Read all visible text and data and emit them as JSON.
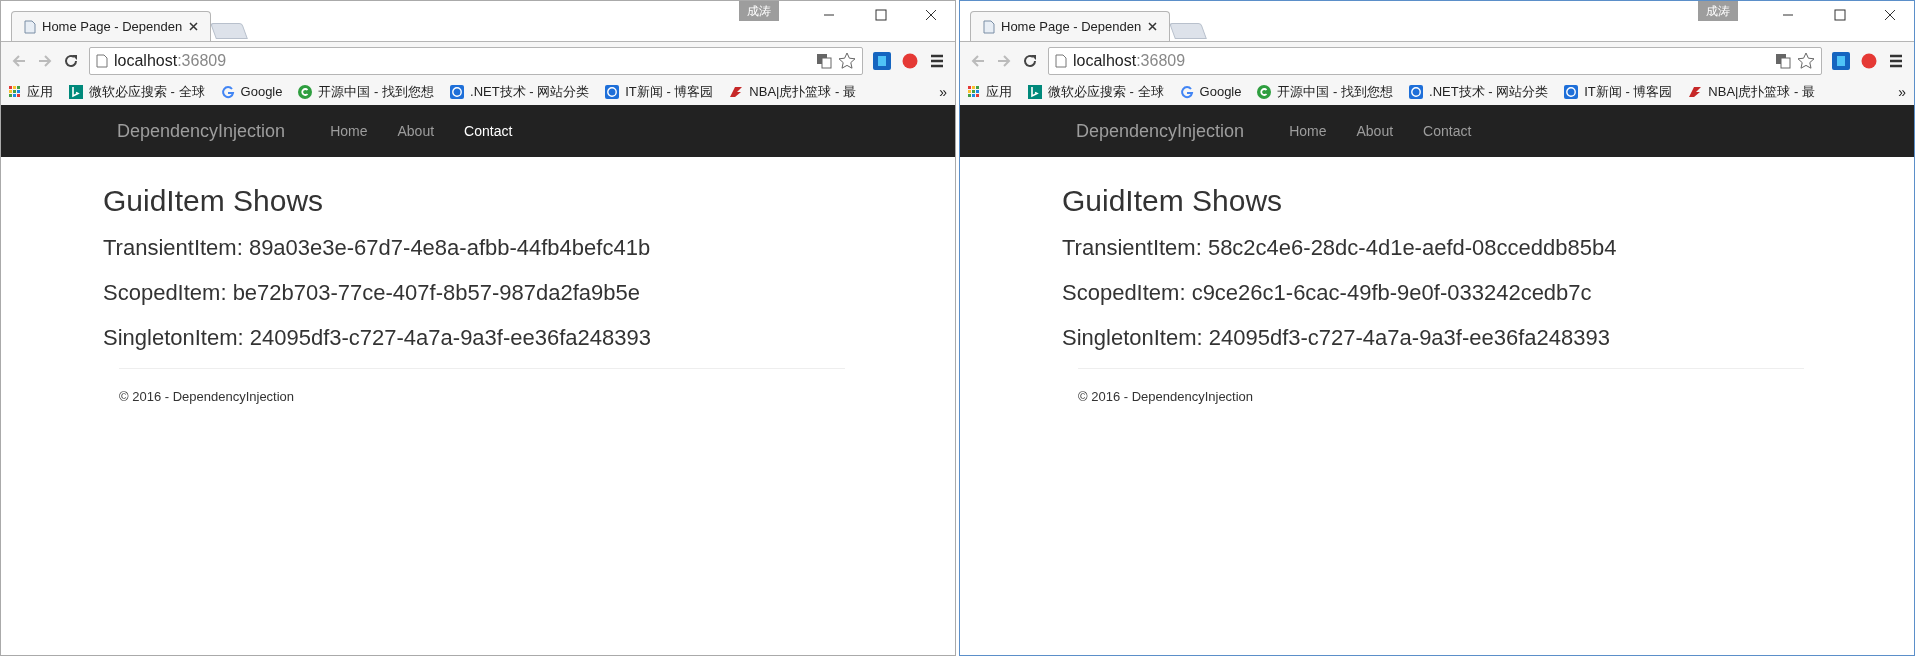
{
  "windows": [
    {
      "tab_title": "Home Page - Dependen",
      "user_badge": "成涛",
      "address": {
        "host": "localhost",
        "port": ":36809"
      },
      "bookmarks": [
        "应用",
        "微软必应搜索 - 全球",
        "Google",
        "开源中国 - 找到您想",
        ".NET技术 - 网站分类",
        "IT新闻 - 博客园",
        "NBA|虎扑篮球 - 最"
      ],
      "more": "»",
      "nav": {
        "brand": "DependencyInjection",
        "items": [
          {
            "label": "Home",
            "selected": false
          },
          {
            "label": "About",
            "selected": false
          },
          {
            "label": "Contact",
            "selected": true
          }
        ]
      },
      "heading": "GuidItem Shows",
      "items": [
        "TransientItem: 89a03e3e-67d7-4e8a-afbb-44fb4befc41b",
        "ScopedItem: be72b703-77ce-407f-8b57-987da2fa9b5e",
        "SingletonItem: 24095df3-c727-4a7a-9a3f-ee36fa248393"
      ],
      "footer": "© 2016 - DependencyInjection",
      "focused": false
    },
    {
      "tab_title": "Home Page - Dependen",
      "user_badge": "成涛",
      "address": {
        "host": "localhost",
        "port": ":36809"
      },
      "bookmarks": [
        "应用",
        "微软必应搜索 - 全球",
        "Google",
        "开源中国 - 找到您想",
        ".NET技术 - 网站分类",
        "IT新闻 - 博客园",
        "NBA|虎扑篮球 - 最"
      ],
      "more": "»",
      "nav": {
        "brand": "DependencyInjection",
        "items": [
          {
            "label": "Home",
            "selected": false
          },
          {
            "label": "About",
            "selected": false
          },
          {
            "label": "Contact",
            "selected": false
          }
        ]
      },
      "heading": "GuidItem Shows",
      "items": [
        "TransientItem: 58c2c4e6-28dc-4d1e-aefd-08cceddb85b4",
        "ScopedItem: c9ce26c1-6cac-49fb-9e0f-033242cedb7c",
        "SingletonItem: 24095df3-c727-4a7a-9a3f-ee36fa248393"
      ],
      "footer": "© 2016 - DependencyInjection",
      "focused": true
    }
  ]
}
